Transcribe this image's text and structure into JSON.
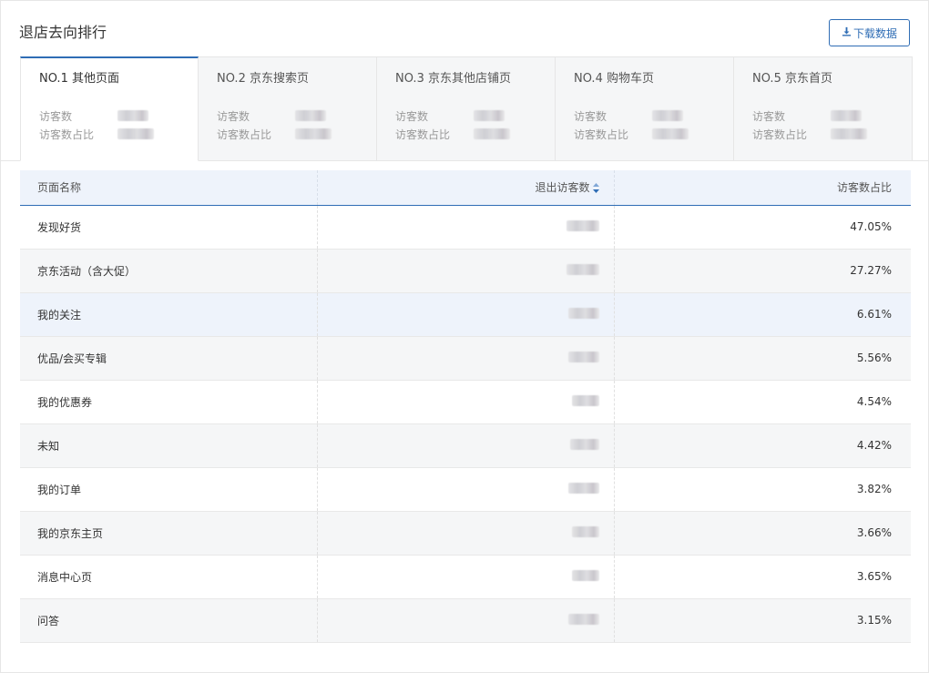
{
  "header": {
    "title": "退店去向排行",
    "download_label": "下载数据",
    "download_icon": "download-icon"
  },
  "colors": {
    "accent": "#2f6db5",
    "tab_bg": "#f5f6f7",
    "header_bg": "#eef3fb"
  },
  "tabs": [
    {
      "title": "NO.1 其他页面",
      "visitors_label": "访客数",
      "share_label": "访客数占比",
      "active": true
    },
    {
      "title": "NO.2 京东搜索页",
      "visitors_label": "访客数",
      "share_label": "访客数占比",
      "active": false
    },
    {
      "title": "NO.3 京东其他店铺页",
      "visitors_label": "访客数",
      "share_label": "访客数占比",
      "active": false
    },
    {
      "title": "NO.4 购物车页",
      "visitors_label": "访客数",
      "share_label": "访客数占比",
      "active": false
    },
    {
      "title": "NO.5 京东首页",
      "visitors_label": "访客数",
      "share_label": "访客数占比",
      "active": false
    }
  ],
  "table": {
    "columns": [
      "页面名称",
      "退出访客数",
      "访客数占比"
    ],
    "sort_icon": "sort-icon",
    "rows": [
      {
        "name": "发现好货",
        "share": "47.05%"
      },
      {
        "name": "京东活动（含大促）",
        "share": "27.27%"
      },
      {
        "name": "我的关注",
        "share": "6.61%"
      },
      {
        "name": "优品/会买专辑",
        "share": "5.56%"
      },
      {
        "name": "我的优惠券",
        "share": "4.54%"
      },
      {
        "name": "未知",
        "share": "4.42%"
      },
      {
        "name": "我的订单",
        "share": "3.82%"
      },
      {
        "name": "我的京东主页",
        "share": "3.66%"
      },
      {
        "name": "消息中心页",
        "share": "3.65%"
      },
      {
        "name": "问答",
        "share": "3.15%"
      }
    ]
  }
}
